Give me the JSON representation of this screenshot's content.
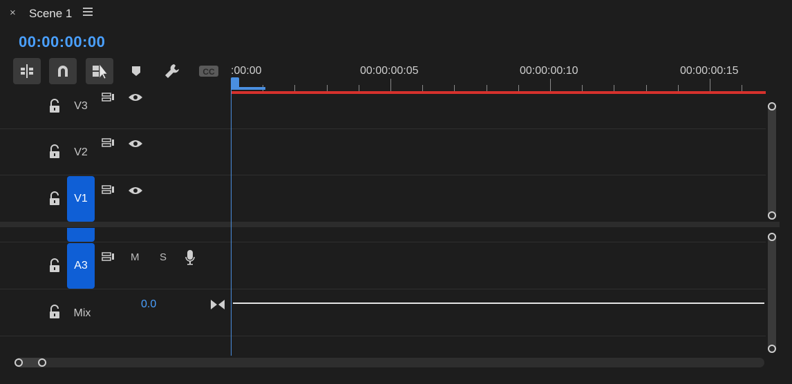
{
  "header": {
    "close_label": "×",
    "tab_title": "Scene 1",
    "timecode": "00:00:00:00"
  },
  "toolbar": {
    "tools": [
      {
        "name": "insert-nest-tool",
        "icon": "nest-icon",
        "active": true
      },
      {
        "name": "snap-tool",
        "icon": "magnet-icon",
        "active": true
      },
      {
        "name": "linked-selection-tool",
        "icon": "linked-selection-icon",
        "active": true
      },
      {
        "name": "add-marker-tool",
        "icon": "marker-icon",
        "active": false
      },
      {
        "name": "settings-tool",
        "icon": "wrench-icon",
        "active": false
      },
      {
        "name": "captions-tool",
        "icon": "cc-icon",
        "active": false,
        "label": "CC"
      }
    ]
  },
  "ruler": {
    "labels": [
      ":00:00",
      "00:00:00:05",
      "00:00:00:10",
      "00:00:00:15"
    ]
  },
  "tracks": {
    "video": [
      {
        "name": "V3",
        "targeted": false
      },
      {
        "name": "V2",
        "targeted": false
      },
      {
        "name": "V1",
        "targeted": true
      }
    ],
    "audio": [
      {
        "name": "A3",
        "targeted": true,
        "mute_label": "M",
        "solo_label": "S"
      }
    ],
    "mix": {
      "name": "Mix",
      "value": "0.0"
    }
  },
  "colors": {
    "accent_blue": "#4aa0ff",
    "track_target": "#0f5fd6",
    "work_area_red": "#d6312c",
    "background": "#1d1d1d"
  }
}
